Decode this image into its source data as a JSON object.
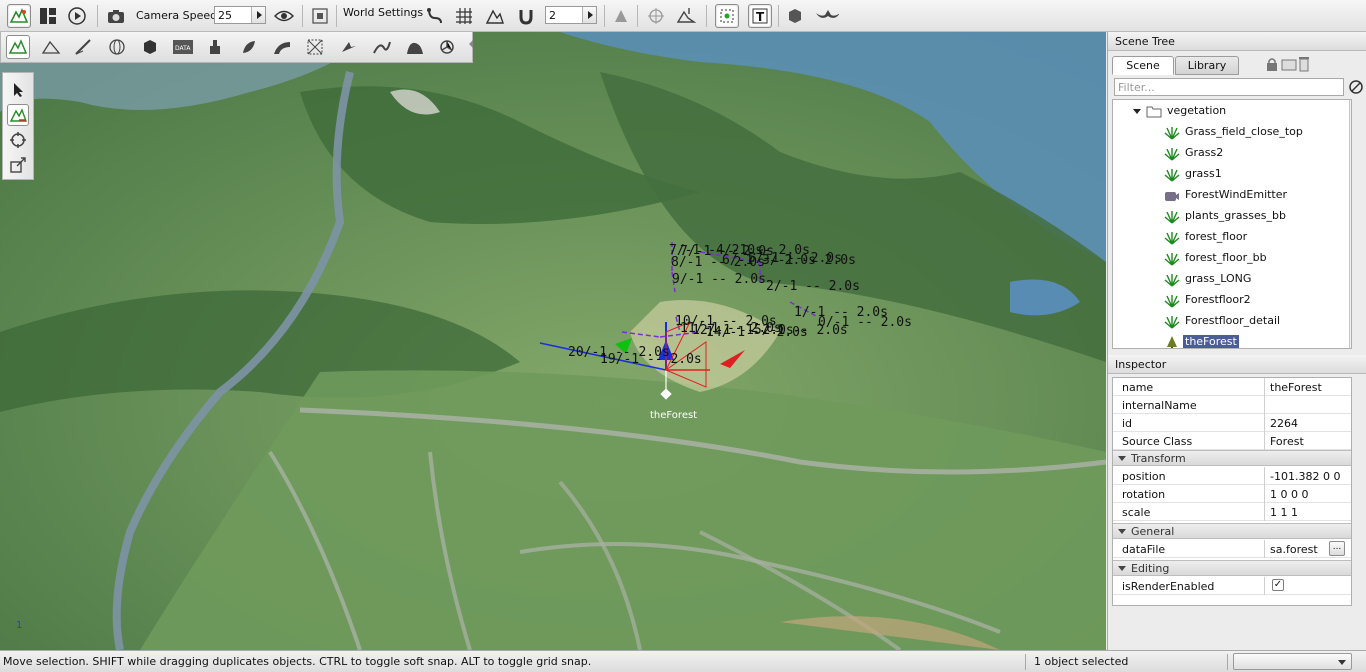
{
  "toolbar": {
    "camera_speed_label": "Camera Speed",
    "camera_speed_value": "25",
    "world_settings_label": "World Settings",
    "snap_value": "2"
  },
  "secondary_toolbar": {
    "data_icon_text": "DATA"
  },
  "viewport": {
    "selected_object_label": "theForest",
    "axis_indicator": "1",
    "path_labels": [
      "7/-1 -- 2.0s",
      "7/-1 -- 2.0s",
      "4/-1 -- 2.0s",
      "8/-1 -- 2.0s",
      "6/-1 -- 2.0s",
      "5/-1 -- 2.0s",
      "3/-1 -- 2.0s",
      "9/-1 -- 2.0s",
      "2/-1 -- 2.0s",
      "1/-1 -- 2.0s",
      "0/-1 -- 2.0s",
      "10/-1 -- 2.0s",
      "20/-1 -- 2.0s",
      "19/-1 -- 2.0s",
      "11/-1 -- 2.0s",
      "12/-1 -- 2.0s",
      "14/-1 -- 2.0s",
      "15/-1 -- 2.0s"
    ]
  },
  "scene_tree": {
    "title": "Scene Tree",
    "tabs": [
      "Scene",
      "Library"
    ],
    "filter_placeholder": "Filter...",
    "folder": "vegetation",
    "items": [
      {
        "label": "Grass_field_close_top",
        "icon": "grass-icon"
      },
      {
        "label": "Grass2",
        "icon": "grass-icon"
      },
      {
        "label": "grass1",
        "icon": "grass-icon"
      },
      {
        "label": "ForestWindEmitter",
        "icon": "wind-emitter-icon"
      },
      {
        "label": "plants_grasses_bb",
        "icon": "grass-icon"
      },
      {
        "label": "forest_floor",
        "icon": "grass-icon"
      },
      {
        "label": "forest_floor_bb",
        "icon": "grass-icon"
      },
      {
        "label": "grass_LONG",
        "icon": "grass-icon"
      },
      {
        "label": "Forestfloor2",
        "icon": "grass-icon"
      },
      {
        "label": "Forestfloor_detail",
        "icon": "grass-icon"
      },
      {
        "label": "theForest",
        "icon": "forest-icon",
        "selected": true
      }
    ]
  },
  "inspector": {
    "title": "Inspector",
    "fields": [
      {
        "key": "name",
        "value": "theForest"
      },
      {
        "key": "internalName",
        "value": ""
      },
      {
        "key": "id",
        "value": "2264"
      },
      {
        "key": "Source Class",
        "value": "Forest"
      }
    ],
    "groups": [
      {
        "title": "Transform",
        "fields": [
          {
            "key": "position",
            "value": "-101.382 0 0"
          },
          {
            "key": "rotation",
            "value": "1 0 0 0"
          },
          {
            "key": "scale",
            "value": "1 1 1"
          }
        ]
      },
      {
        "title": "General",
        "fields": [
          {
            "key": "dataFile",
            "value": "sa.forest",
            "button": "..."
          }
        ]
      },
      {
        "title": "Editing",
        "fields": [
          {
            "key": "isRenderEnabled",
            "checked": true
          }
        ]
      }
    ]
  },
  "statusbar": {
    "message": "Move selection.  SHIFT while dragging duplicates objects.  CTRL to toggle soft snap.  ALT to toggle grid snap.",
    "selection": "1 object selected"
  },
  "colors": {
    "selection": "#4a5d98",
    "gizmo_x": "#e02020",
    "gizmo_y": "#10c010",
    "gizmo_z": "#1a2de0",
    "path": "#7a2fd0"
  }
}
